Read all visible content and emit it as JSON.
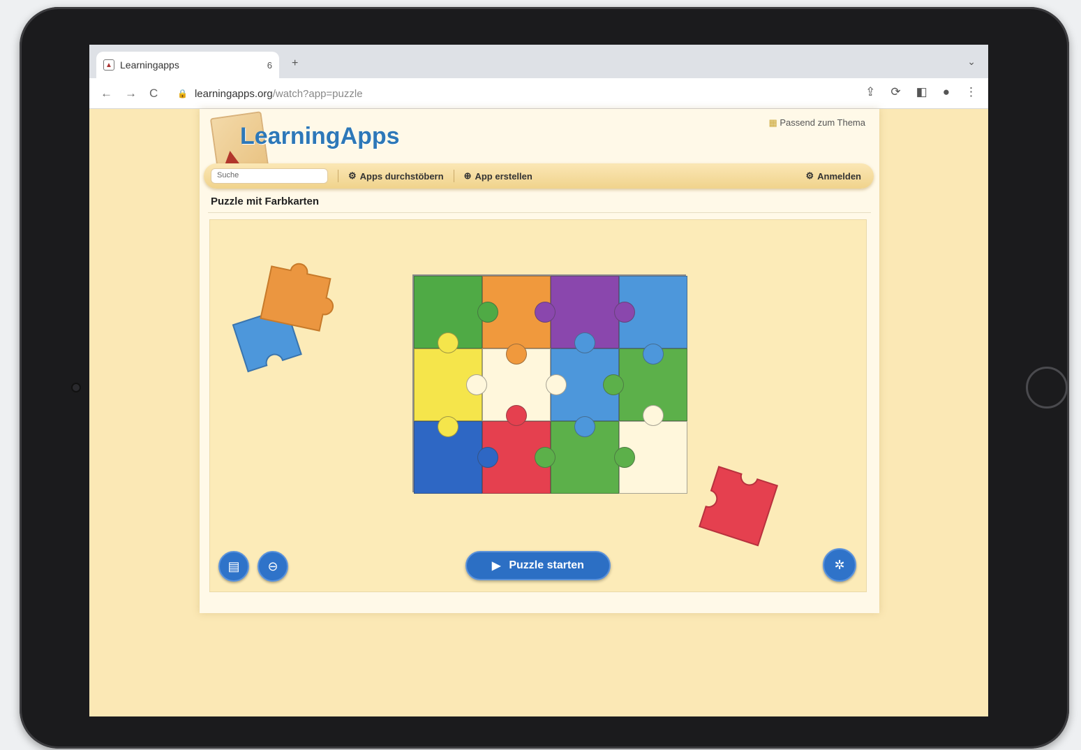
{
  "browser": {
    "tab_title": "Learningapps",
    "tab_close": "6",
    "new_tab": "+",
    "url_host": "learningapps.org",
    "url_path": "/watch?app=puzzle",
    "nav": {
      "back": "←",
      "forward": "→",
      "reload": "C"
    }
  },
  "site": {
    "logo_text": "LearningApps",
    "top_link": "Passend zum Thema",
    "search_placeholder": "Suche",
    "menu": {
      "item1": "Apps durchstöbern",
      "item2": "App erstellen",
      "item3": "Anmelden"
    }
  },
  "app": {
    "title": "Puzzle mit Farbkarten",
    "start_label": "Puzzle starten"
  },
  "puzzle": {
    "rows": 3,
    "cols": 4,
    "colors": [
      "#4faa45",
      "#f0993d",
      "#8a47ad",
      "#4d97db",
      "#f5e54b",
      "#fff7dc",
      "#4d97db",
      "#5cb04a",
      "#2e67c4",
      "#e5404f",
      "#5cb04a",
      "#fff7dc"
    ]
  },
  "icons": {
    "menu1": "gear-icon",
    "menu2": "plus-icon",
    "menu3": "login-icon",
    "btn_left1": "grid-icon",
    "btn_left2": "fullscreen-icon",
    "btn_right": "settings-icon"
  }
}
